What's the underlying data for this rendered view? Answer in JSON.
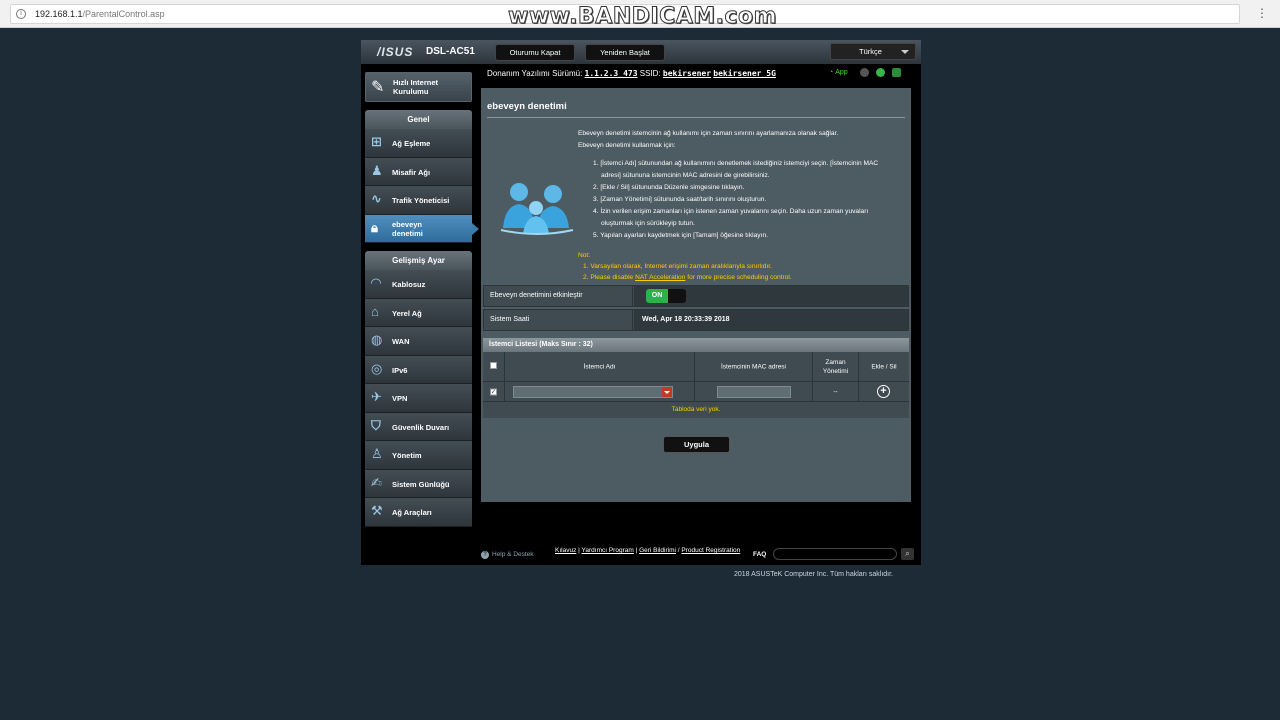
{
  "browser": {
    "url_host": "192.168.1.1",
    "url_path": "/ParentalControl.asp",
    "watermark": "www.BANDICAM.com"
  },
  "router": {
    "brand": "/ISUS",
    "model": "DSL-AC51",
    "logout_label": "Oturumu Kapat",
    "reboot_label": "Yeniden Başlat",
    "language": "Türkçe",
    "fw_label": "Donanım Yazılımı Sürümü:",
    "fw_version": "1.1.2.3_473",
    "ssid_label": "SSID:",
    "ssid1": "bekirsener",
    "ssid2": "bekirsener_5G",
    "app_label": "App",
    "accent": "#4f8fbf"
  },
  "sidebar": {
    "quick_setup": "Hızlı Internet Kurulumu",
    "general_header": "Genel",
    "general_items": [
      {
        "label": "Ağ Eşleme",
        "icon": "network-map-icon"
      },
      {
        "label": "Misafir Ağı",
        "icon": "guest-network-icon"
      },
      {
        "label": "Trafik Yöneticisi",
        "icon": "traffic-manager-icon"
      },
      {
        "label": "ebeveyn denetimi",
        "icon": "lock-icon"
      }
    ],
    "advanced_header": "Gelişmiş Ayar",
    "advanced_items": [
      {
        "label": "Kablosuz",
        "icon": "wireless-icon"
      },
      {
        "label": "Yerel Ağ",
        "icon": "lan-home-icon"
      },
      {
        "label": "WAN",
        "icon": "globe-icon"
      },
      {
        "label": "IPv6",
        "icon": "ipv6-globe-icon"
      },
      {
        "label": "VPN",
        "icon": "vpn-icon"
      },
      {
        "label": "Güvenlik Duvarı",
        "icon": "shield-icon"
      },
      {
        "label": "Yönetim",
        "icon": "user-admin-icon"
      },
      {
        "label": "Sistem Günlüğü",
        "icon": "system-log-icon"
      },
      {
        "label": "Ağ Araçları",
        "icon": "tools-icon"
      }
    ]
  },
  "content": {
    "title": "ebeveyn denetimi",
    "intro1": "Ebeveyn denetimi istemcinin ağ kullanımı için zaman sınırını ayarlamanıza olanak sağlar.",
    "intro2": "Ebeveyn denetimi kullanmak için:",
    "steps": [
      "1. [İstemci Adı] sütunundan ağ kullanımını denetlemek istediğiniz istemciyi seçin. [İstemcinin MAC adresi] sütununa istemcinin MAC adresini de girebilirsiniz.",
      "2. [Ekle / Sil] sütununda Düzenle simgesine tıklayın.",
      "3. [Zaman Yönetimi] sütununda saat/tarih sınırını oluşturun.",
      "4. İzin verilen erişim zamanları için istenen zaman yuvalarını seçin. Daha uzun zaman yuvaları oluşturmak için sürükleyip tutun.",
      "5. Yapılan ayarları kaydetmek için [Tamam] öğesine tıklayın."
    ],
    "note_label": "Not:",
    "note1": "1. Varsayılan olarak, Internet erişimi zaman aralıklarıyla sınırlıdır.",
    "note2_pre": "2. Please disable ",
    "note2_link": "NAT Acceleration",
    "note2_post": " for more precise scheduling control.",
    "enable_label": "Ebeveyn denetimini etkinleştir",
    "toggle_state": "ON",
    "time_label": "Sistem Saati",
    "time_value": "Wed, Apr 18 20:33:39 2018",
    "table_title": "İstemci Listesi (Maks Sınır : 32)",
    "col_client": "İstemci Adı",
    "col_mac": "İstemcinin MAC adresi",
    "col_time": "Zaman Yönetimi",
    "col_add": "Ekle / Sil",
    "row_time_value": "--",
    "empty_text": "Tabloda veri yok.",
    "apply_label": "Uygula"
  },
  "footer": {
    "help_label": "Help & Destek",
    "link1": "Kılavuz",
    "link2": "Yardımcı Program",
    "link3": "Geri Bildirimi",
    "link4": "Product Registration",
    "faq_label": "FAQ",
    "copyright": "2018 ASUSTeK Computer Inc. Tüm hakları saklıdır."
  }
}
